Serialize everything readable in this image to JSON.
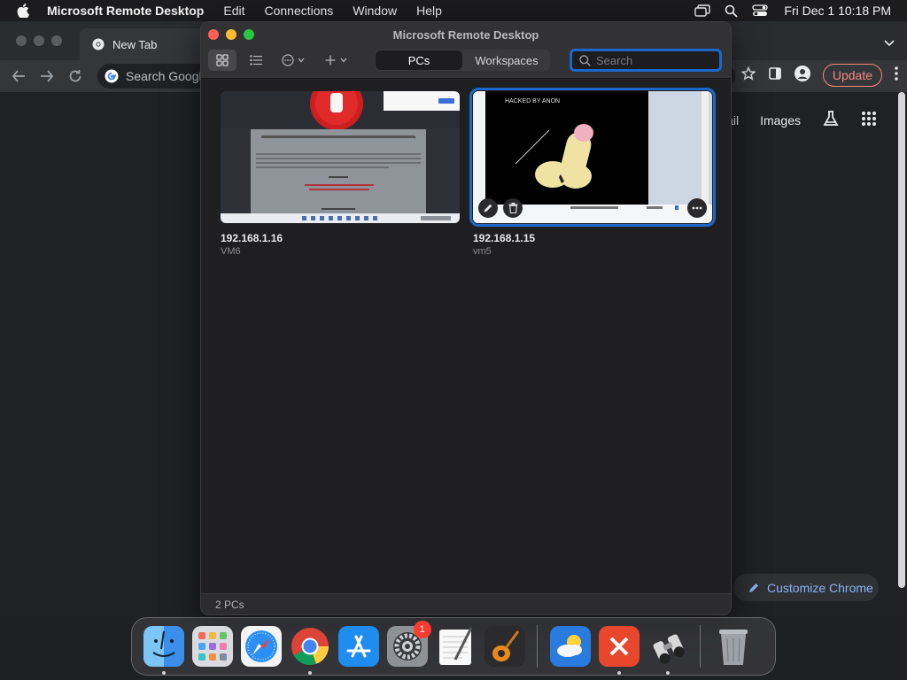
{
  "menubar": {
    "app_name": "Microsoft Remote Desktop",
    "menus": [
      "Edit",
      "Connections",
      "Window",
      "Help"
    ],
    "clock": "Fri Dec 1  10:18 PM"
  },
  "chrome": {
    "tab_title": "New Tab",
    "omnibox_placeholder": "Search Google or type a URL",
    "update_label": "Update",
    "gmail_label": "Gmail",
    "images_label": "Images",
    "customize_label": "Customize Chrome"
  },
  "rdwindow": {
    "title": "Microsoft Remote Desktop",
    "tabs": [
      {
        "label": "PCs",
        "active": true
      },
      {
        "label": "Workspaces",
        "active": false
      }
    ],
    "search_placeholder": "Search",
    "pcs": [
      {
        "name": "192.168.1.16",
        "label": "VM6",
        "selected": false
      },
      {
        "name": "192.168.1.15",
        "label": "vm5",
        "selected": true,
        "thumbnail_text": "HACKED BY ANON"
      }
    ],
    "footer": "2 PCs"
  },
  "dock": {
    "items": [
      "finder-icon",
      "launchpad-icon",
      "safari-icon",
      "chrome-icon",
      "app-store-icon",
      "system-settings-icon",
      "textedit-icon",
      "garageband-icon",
      "weather-icon",
      "remote-desktop-icon",
      "binoculars-icon",
      "trash-icon"
    ],
    "settings_badge": "1"
  },
  "colors": {
    "accent": "#1d67c9",
    "window_bg": "#252528",
    "close": "#ff5f57",
    "minimize": "#febc2e",
    "zoom": "#28c840"
  }
}
